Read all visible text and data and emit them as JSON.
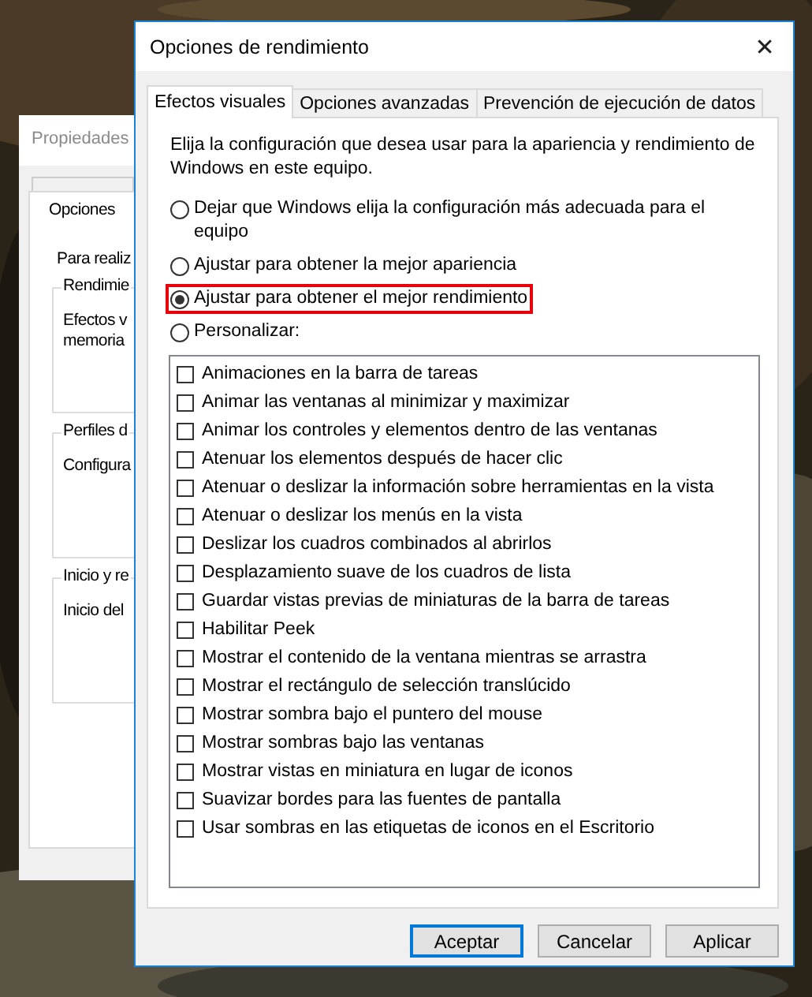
{
  "back_window": {
    "title": "Propiedades",
    "tab": "Opciones",
    "intro": "Para realiz",
    "groups": [
      {
        "title": "Rendimie",
        "lines": [
          "Efectos v",
          "memoria"
        ]
      },
      {
        "title": "Perfiles d",
        "lines": [
          "Configura"
        ]
      },
      {
        "title": "Inicio y re",
        "lines": [
          "Inicio del"
        ]
      }
    ]
  },
  "dialog": {
    "title": "Opciones de rendimiento",
    "close": "✕",
    "tabs": [
      {
        "label": "Efectos visuales",
        "selected": true
      },
      {
        "label": "Opciones avanzadas",
        "selected": false
      },
      {
        "label": "Prevención de ejecución de datos",
        "selected": false
      }
    ],
    "description": "Elija la configuración que desea usar para la apariencia y rendimiento de Windows en este equipo.",
    "options": [
      {
        "label": "Dejar que Windows elija la configuración más adecuada para el equipo",
        "selected": false,
        "highlighted": false
      },
      {
        "label": "Ajustar para obtener la mejor apariencia",
        "selected": false,
        "highlighted": false
      },
      {
        "label": "Ajustar para obtener el mejor rendimiento",
        "selected": true,
        "highlighted": true
      },
      {
        "label": "Personalizar:",
        "selected": false,
        "highlighted": false
      }
    ],
    "effects": [
      {
        "label": "Animaciones en la barra de tareas",
        "checked": false
      },
      {
        "label": "Animar las ventanas al minimizar y maximizar",
        "checked": false
      },
      {
        "label": "Animar los controles y elementos dentro de las ventanas",
        "checked": false
      },
      {
        "label": "Atenuar los elementos después de hacer clic",
        "checked": false
      },
      {
        "label": "Atenuar o deslizar la información sobre herramientas en la vista",
        "checked": false
      },
      {
        "label": "Atenuar o deslizar los menús en la vista",
        "checked": false
      },
      {
        "label": "Deslizar los cuadros combinados al abrirlos",
        "checked": false
      },
      {
        "label": "Desplazamiento suave de los cuadros de lista",
        "checked": false
      },
      {
        "label": "Guardar vistas previas de miniaturas de la barra de tareas",
        "checked": false
      },
      {
        "label": "Habilitar Peek",
        "checked": false
      },
      {
        "label": "Mostrar el contenido de la ventana mientras se arrastra",
        "checked": false
      },
      {
        "label": "Mostrar el rectángulo de selección translúcido",
        "checked": false
      },
      {
        "label": "Mostrar sombra bajo el puntero del mouse",
        "checked": false
      },
      {
        "label": "Mostrar sombras bajo las ventanas",
        "checked": false
      },
      {
        "label": "Mostrar vistas en miniatura en lugar de iconos",
        "checked": false
      },
      {
        "label": "Suavizar bordes para las fuentes de pantalla",
        "checked": false
      },
      {
        "label": "Usar sombras en las etiquetas de iconos en el Escritorio",
        "checked": false
      }
    ],
    "buttons": [
      {
        "label": "Aceptar",
        "default": true
      },
      {
        "label": "Cancelar",
        "default": false
      },
      {
        "label": "Aplicar",
        "default": false
      }
    ]
  }
}
